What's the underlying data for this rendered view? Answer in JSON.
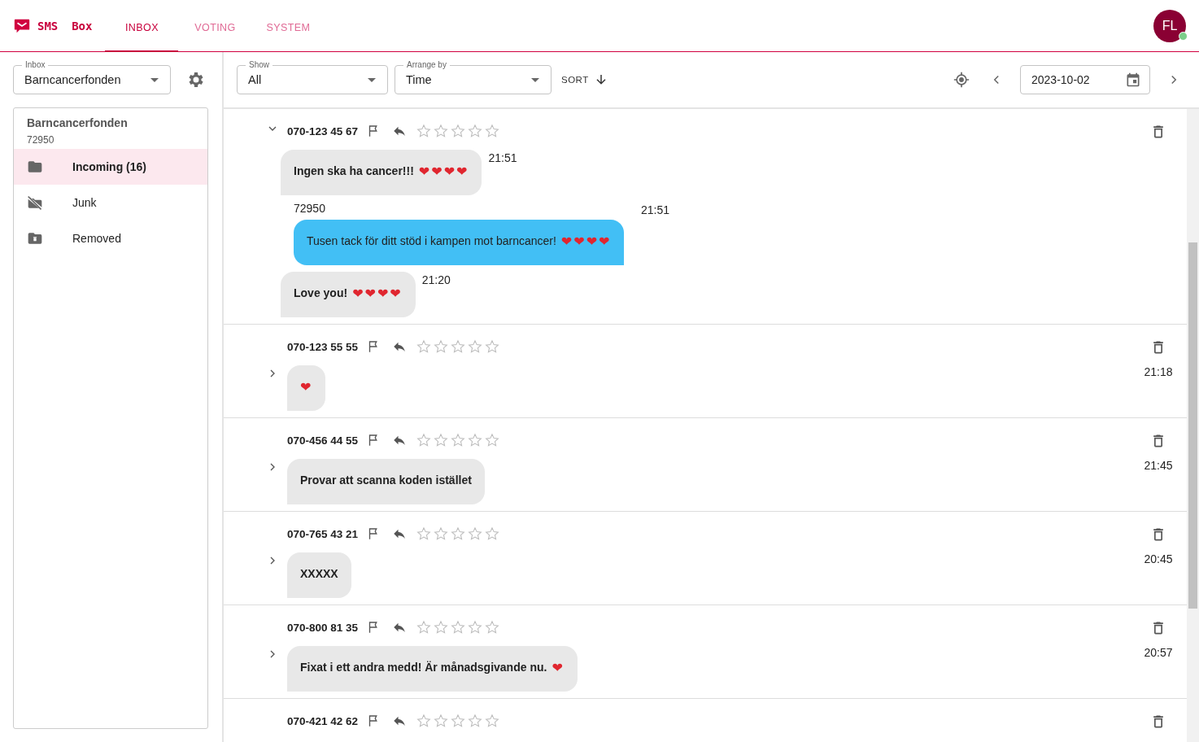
{
  "app": {
    "name": "SMS  Box"
  },
  "tabs": [
    {
      "label": "INBOX",
      "selected": true
    },
    {
      "label": "VOTING",
      "selected": false
    },
    {
      "label": "SYSTEM",
      "selected": false
    }
  ],
  "user": {
    "initials": "FL",
    "online": true
  },
  "sidebar": {
    "inbox_select": {
      "label": "Inbox",
      "value": "Barncancerfonden"
    },
    "account": {
      "name": "Barncancerfonden",
      "number": "72950"
    },
    "folders": [
      {
        "kind": "folder",
        "label": "Incoming (16)",
        "selected": true
      },
      {
        "kind": "junk",
        "label": "Junk",
        "selected": false
      },
      {
        "kind": "removed",
        "label": "Removed",
        "selected": false
      }
    ]
  },
  "toolbar": {
    "show": {
      "label": "Show",
      "value": "All"
    },
    "arrange": {
      "label": "Arrange by",
      "value": "Time"
    },
    "sort": "SORT",
    "date": "2023-10-02"
  },
  "conversations": [
    {
      "phone": "070-123 45 67",
      "expanded": true,
      "stars": 0,
      "messages": [
        {
          "kind": "incoming",
          "text": "Ingen ska ha cancer!!!",
          "emoji": "❤❤❤❤",
          "time": "21:51"
        },
        {
          "kind": "outgoing",
          "sender": "72950",
          "text": "Tusen tack för ditt stöd i kampen mot barncancer!",
          "emoji": "❤❤❤❤",
          "time": "21:51"
        },
        {
          "kind": "incoming",
          "text": "Love you!",
          "emoji": "❤❤❤❤",
          "time": "21:20"
        }
      ]
    },
    {
      "phone": "070-123 55 55",
      "expanded": false,
      "stars": 0,
      "time": "21:18",
      "messages": [
        {
          "kind": "incoming",
          "emoji": "❤"
        }
      ]
    },
    {
      "phone": "070-456 44 55",
      "expanded": false,
      "stars": 0,
      "time": "21:45",
      "messages": [
        {
          "kind": "incoming",
          "text": "Provar att scanna koden istället"
        }
      ]
    },
    {
      "phone": "070-765 43 21",
      "expanded": false,
      "stars": 0,
      "time": "20:45",
      "messages": [
        {
          "kind": "incoming",
          "text": "XXXXX"
        }
      ]
    },
    {
      "phone": "070-800 81 35",
      "expanded": false,
      "stars": 0,
      "time": "20:57",
      "messages": [
        {
          "kind": "incoming",
          "text": "Fixat i ett andra medd! Är månadsgivande nu.",
          "emoji": "❤"
        }
      ]
    },
    {
      "phone": "070-421 42 62",
      "stars": 0
    }
  ]
}
